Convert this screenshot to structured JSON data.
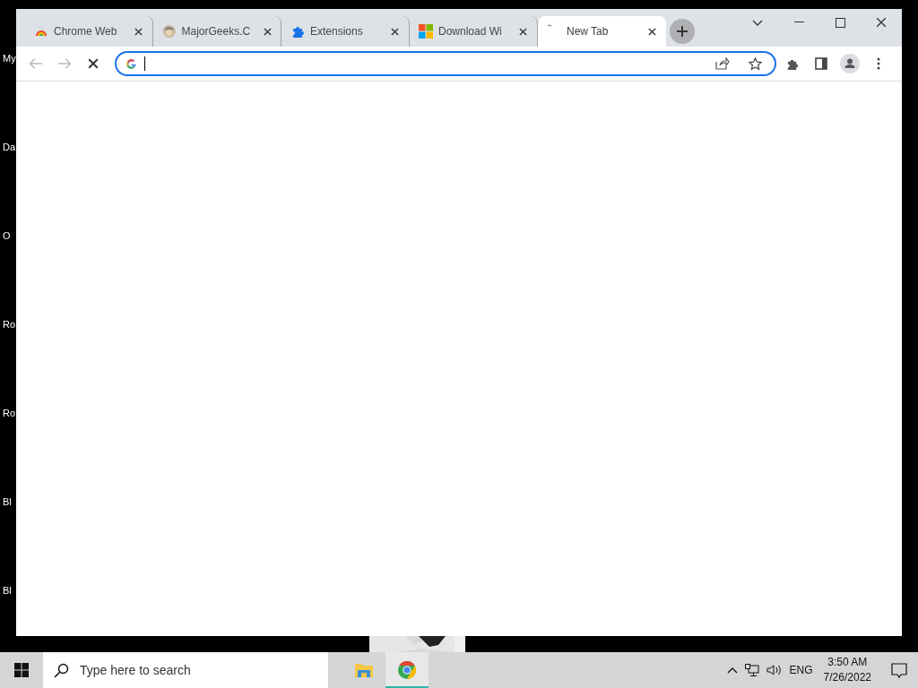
{
  "desktop": {
    "icons": [
      {
        "label": "My"
      },
      {
        "label": "Da"
      },
      {
        "label": "O"
      },
      {
        "label": "Ro"
      },
      {
        "label": "Ro"
      },
      {
        "label": "Bl"
      },
      {
        "label": "Bl"
      }
    ]
  },
  "browser": {
    "tabs": [
      {
        "title": "Chrome Web",
        "kind": "rainbow",
        "selected": false
      },
      {
        "title": "MajorGeeks.C",
        "kind": "geek",
        "selected": false
      },
      {
        "title": "Extensions",
        "kind": "puzzle",
        "selected": false
      },
      {
        "title": "Download Wi",
        "kind": "squares",
        "selected": false
      },
      {
        "title": "New Tab",
        "kind": "spinner",
        "selected": true
      }
    ],
    "loading": true,
    "address_focused": true
  },
  "taskbar": {
    "search": {
      "placeholder": "Type here to search"
    },
    "apps": [
      {
        "kind": "folder",
        "active": false
      },
      {
        "kind": "chrome",
        "active": true
      }
    ],
    "tray": {
      "language": "ENG",
      "time": "3:50 AM",
      "date": "7/26/2022"
    }
  }
}
